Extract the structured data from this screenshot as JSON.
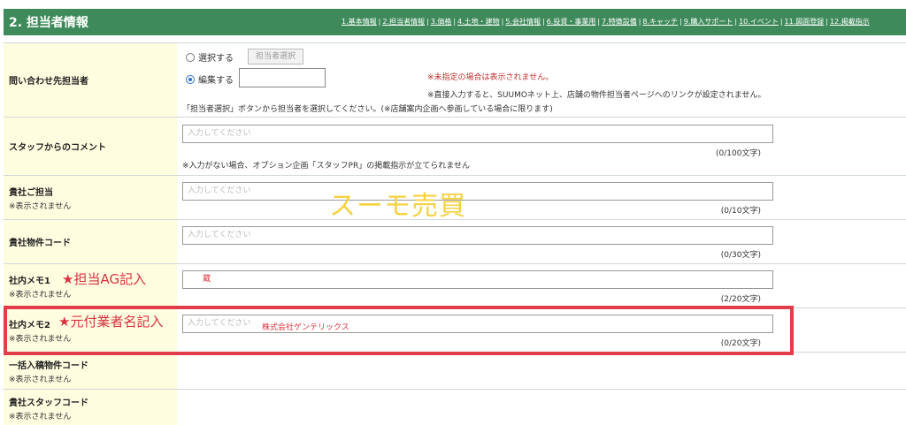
{
  "header": {
    "title": "2. 担当者情報",
    "nav": [
      "1.基本情報",
      "2.担当者情報",
      "3.価格",
      "4.土地・建物",
      "5.会社情報",
      "6.投資・事業用",
      "7.特徴設備",
      "8.キャッチ",
      "9.購入サポート",
      "10.イベント",
      "11.図面登録",
      "12.掲載指示"
    ]
  },
  "contact": {
    "label": "問い合わせ先担当者",
    "radio_select_label": "選択する",
    "radio_edit_label": "編集する",
    "select_button_label": "担当者選択",
    "notice_unassigned": "※未指定の場合は表示されません。",
    "notice_direct": "※直接入力すると、SUUMOネット上、店舗の物件担当者ページへのリンクが設定されません。",
    "instruction": "「担当者選択」ボタンから担当者を選択してください。(※店舗案内企画へ参画している場合に限ります)"
  },
  "staff_comment": {
    "label": "スタッフからのコメント",
    "placeholder": "入力してください",
    "counter": "(0/100文字)",
    "note": "※入力がない場合、オプション企画「スタッフPR」の掲載指示が立てられません"
  },
  "company_staff": {
    "label": "貴社ご担当",
    "sub": "※表示されません",
    "placeholder": "入力してください",
    "counter": "(0/10文字)"
  },
  "property_code": {
    "label": "貴社物件コード",
    "placeholder": "入力してください",
    "counter": "(0/30文字)"
  },
  "memo1": {
    "label": "社内メモ1",
    "sub": "※表示されません",
    "value": "蔵",
    "counter": "(2/20文字)",
    "annotation": "★担当AG記入"
  },
  "memo2": {
    "label": "社内メモ2",
    "sub": "※表示されません",
    "placeholder": "入力してください",
    "overlay_text": "株式会社ゲンテリックス",
    "counter": "(0/20文字)",
    "annotation": "★元付業者名記入"
  },
  "bulk_code": {
    "label": "一括入稿物件コード",
    "sub": "※表示されません"
  },
  "staff_code": {
    "label": "貴社スタッフコード",
    "sub": "※表示されません"
  },
  "watermark": "スーモ売買"
}
